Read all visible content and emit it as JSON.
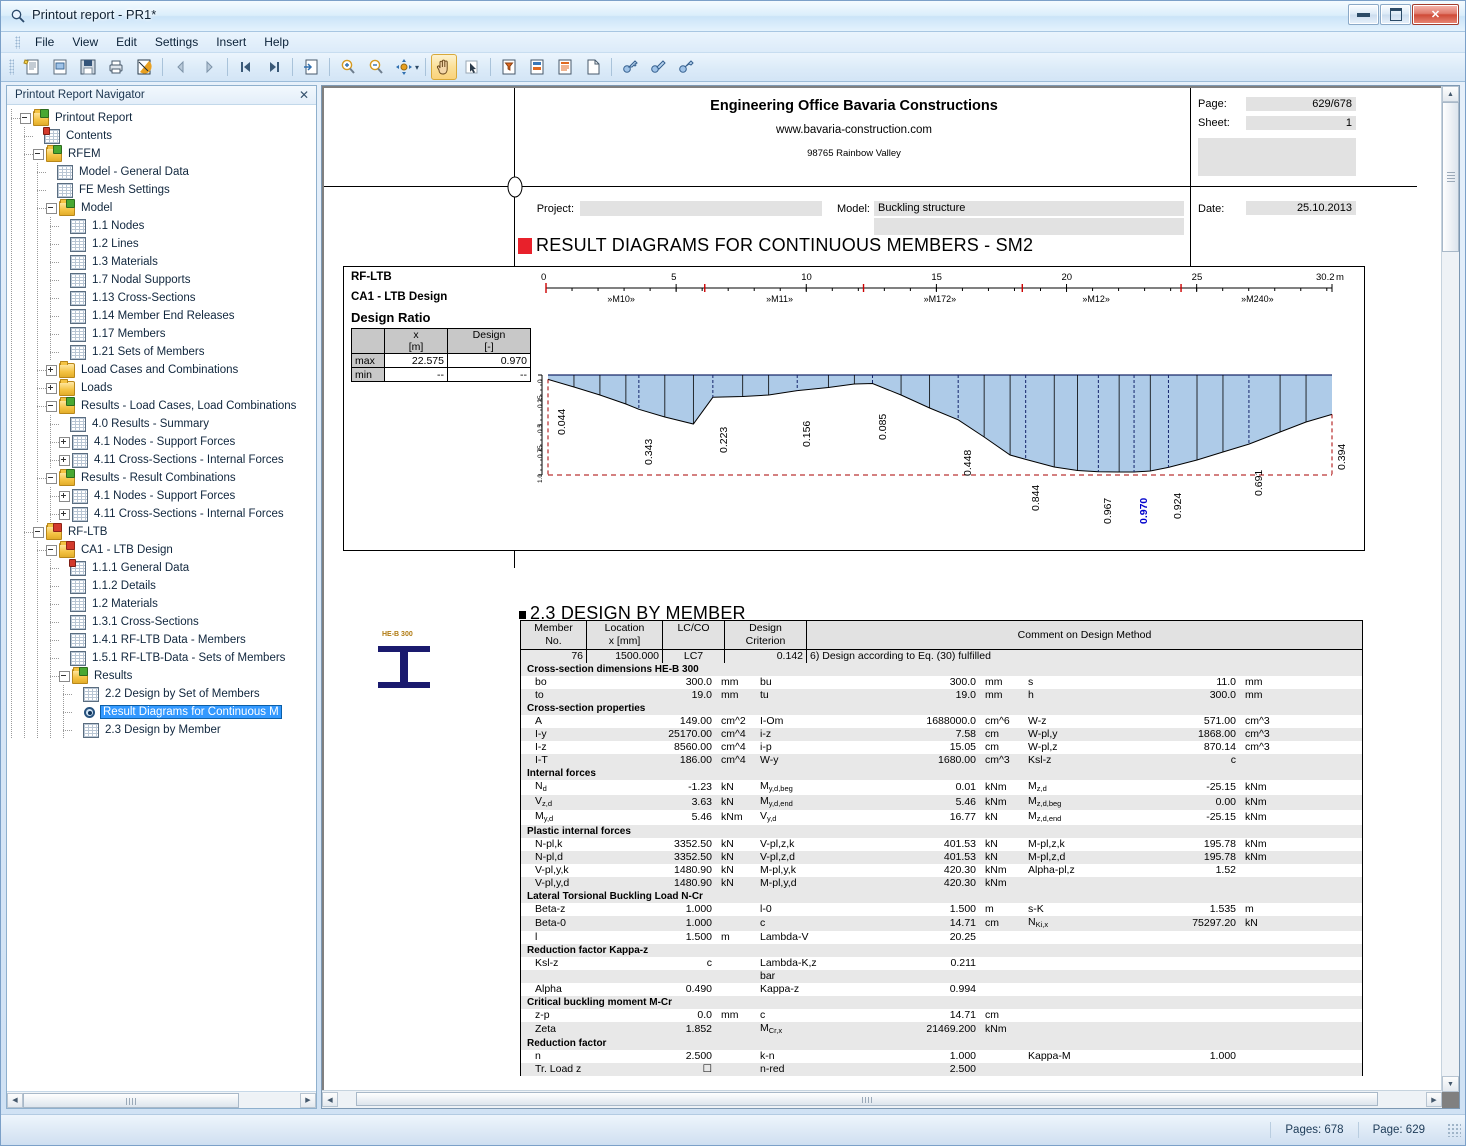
{
  "window": {
    "title": "Printout report - PR1*",
    "icon": "magnifier-icon",
    "minimize": "minimize-button",
    "maximize": "maximize-button",
    "close": "✕"
  },
  "menu": [
    "File",
    "View",
    "Edit",
    "Settings",
    "Insert",
    "Help"
  ],
  "toolbar": {
    "buttons": [
      {
        "name": "new-report-icon",
        "active": false
      },
      {
        "name": "open-report-icon",
        "active": false
      },
      {
        "name": "save-icon",
        "active": false
      },
      {
        "name": "print-icon",
        "active": false
      },
      {
        "name": "print-preview-icon",
        "active": false
      },
      {
        "name": "previous-page-icon",
        "active": false
      },
      {
        "name": "next-page-icon",
        "active": false
      },
      {
        "name": "first-page-icon",
        "active": false
      },
      {
        "name": "last-page-icon",
        "active": false
      },
      {
        "name": "export-icon",
        "active": false
      },
      {
        "name": "zoom-in-icon",
        "active": false
      },
      {
        "name": "zoom-out-icon",
        "active": false
      },
      {
        "name": "pan-move-icon",
        "active": false
      },
      {
        "name": "hand-tool-icon",
        "active": true
      },
      {
        "name": "select-pointer-icon",
        "active": false
      },
      {
        "name": "filter-page-icon",
        "active": false
      },
      {
        "name": "page-properties-icon",
        "active": false
      },
      {
        "name": "page-layout-icon",
        "active": false
      },
      {
        "name": "blank-page-icon",
        "active": false
      },
      {
        "name": "key-insert-icon",
        "active": false
      },
      {
        "name": "key-edit-icon",
        "active": false
      },
      {
        "name": "key-lock-icon",
        "active": false
      }
    ]
  },
  "navigator": {
    "title": "Printout Report Navigator",
    "close_label": "✕",
    "tree": [
      {
        "label": "Printout Report",
        "depth": 0,
        "icon": "folder-green",
        "exp": "minus"
      },
      {
        "label": "Contents",
        "depth": 1,
        "icon": "sheet-pin",
        "exp": ""
      },
      {
        "label": "RFEM",
        "depth": 1,
        "icon": "folder-green",
        "exp": "minus"
      },
      {
        "label": "Model - General Data",
        "depth": 2,
        "icon": "sheet",
        "exp": ""
      },
      {
        "label": "FE Mesh Settings",
        "depth": 2,
        "icon": "sheet",
        "exp": ""
      },
      {
        "label": "Model",
        "depth": 2,
        "icon": "folder-green",
        "exp": "minus"
      },
      {
        "label": "1.1 Nodes",
        "depth": 3,
        "icon": "sheet",
        "exp": ""
      },
      {
        "label": "1.2 Lines",
        "depth": 3,
        "icon": "sheet",
        "exp": ""
      },
      {
        "label": "1.3 Materials",
        "depth": 3,
        "icon": "sheet",
        "exp": ""
      },
      {
        "label": "1.7 Nodal Supports",
        "depth": 3,
        "icon": "sheet",
        "exp": ""
      },
      {
        "label": "1.13 Cross-Sections",
        "depth": 3,
        "icon": "sheet",
        "exp": ""
      },
      {
        "label": "1.14 Member End Releases",
        "depth": 3,
        "icon": "sheet",
        "exp": ""
      },
      {
        "label": "1.17 Members",
        "depth": 3,
        "icon": "sheet",
        "exp": ""
      },
      {
        "label": "1.21 Sets of Members",
        "depth": 3,
        "icon": "sheet",
        "exp": ""
      },
      {
        "label": "Load Cases and Combinations",
        "depth": 2,
        "icon": "folder",
        "exp": "plus"
      },
      {
        "label": "Loads",
        "depth": 2,
        "icon": "folder",
        "exp": "plus"
      },
      {
        "label": "Results - Load Cases, Load Combinations",
        "depth": 2,
        "icon": "folder-green",
        "exp": "minus"
      },
      {
        "label": "4.0 Results - Summary",
        "depth": 3,
        "icon": "sheet",
        "exp": ""
      },
      {
        "label": "4.1 Nodes - Support Forces",
        "depth": 3,
        "icon": "sheet",
        "exp": "plus"
      },
      {
        "label": "4.11 Cross-Sections - Internal Forces",
        "depth": 3,
        "icon": "sheet",
        "exp": "plus"
      },
      {
        "label": "Results - Result Combinations",
        "depth": 2,
        "icon": "folder-green",
        "exp": "minus"
      },
      {
        "label": "4.1 Nodes - Support Forces",
        "depth": 3,
        "icon": "sheet",
        "exp": "plus"
      },
      {
        "label": "4.11 Cross-Sections - Internal Forces",
        "depth": 3,
        "icon": "sheet",
        "exp": "plus"
      },
      {
        "label": "RF-LTB",
        "depth": 1,
        "icon": "folder-red",
        "exp": "minus"
      },
      {
        "label": "CA1 - LTB Design",
        "depth": 2,
        "icon": "folder-red",
        "exp": "minus"
      },
      {
        "label": "1.1.1 General Data",
        "depth": 3,
        "icon": "sheet-pin",
        "exp": ""
      },
      {
        "label": "1.1.2 Details",
        "depth": 3,
        "icon": "sheet",
        "exp": ""
      },
      {
        "label": "1.2 Materials",
        "depth": 3,
        "icon": "sheet",
        "exp": ""
      },
      {
        "label": "1.3.1 Cross-Sections",
        "depth": 3,
        "icon": "sheet",
        "exp": ""
      },
      {
        "label": "1.4.1 RF-LTB Data - Members",
        "depth": 3,
        "icon": "sheet",
        "exp": ""
      },
      {
        "label": "1.5.1 RF-LTB-Data - Sets of Members",
        "depth": 3,
        "icon": "sheet",
        "exp": ""
      },
      {
        "label": "Results",
        "depth": 3,
        "icon": "folder-green",
        "exp": "minus"
      },
      {
        "label": "2.2 Design by Set of Members",
        "depth": 4,
        "icon": "sheet",
        "exp": ""
      },
      {
        "label": "Result Diagrams for Continuous M",
        "depth": 4,
        "icon": "eye",
        "exp": "",
        "selected": true
      },
      {
        "label": "2.3 Design by Member",
        "depth": 4,
        "icon": "sheet",
        "exp": ""
      }
    ]
  },
  "report": {
    "header": {
      "company": "Engineering Office Bavaria Constructions",
      "website": "www.bavaria-construction.com",
      "address": "98765 Rainbow Valley",
      "page_label": "Page:",
      "page_value": "629/678",
      "sheet_label": "Sheet:",
      "sheet_value": "1",
      "project_label": "Project:",
      "project_value": "",
      "model_label": "Model:",
      "model_value": "Buckling structure",
      "date_label": "Date:",
      "date_value": "25.10.2013"
    },
    "section1": {
      "title": "RESULT DIAGRAMS FOR CONTINUOUS MEMBERS -  SM2"
    },
    "diagram": {
      "module": "RF-LTB",
      "case": "CA1 - LTB Design",
      "caption": "Design Ratio",
      "table": {
        "headers": [
          "",
          "x\n[m]",
          "Design\n[-]"
        ],
        "head_x": "x",
        "head_x_unit": "[m]",
        "head_d": "Design",
        "head_d_unit": "[-]",
        "rows": [
          {
            "key": "max",
            "x": "22.575",
            "design": "0.970"
          },
          {
            "key": "min",
            "x": "--",
            "design": "--"
          }
        ]
      },
      "unit_suffix": "m"
    },
    "section2": {
      "title": "2.3 DESIGN BY MEMBER",
      "headers": {
        "member": "Member",
        "member2": "No.",
        "location": "Location",
        "location2": "x [mm]",
        "lcco": "LC/CO",
        "design": "Design",
        "design2": "Criterion",
        "comment": "Comment on Design Method"
      },
      "first_row": {
        "member_no": "76",
        "location": "1500.000",
        "lcco": "LC7",
        "criterion": "0.142",
        "comment": "6) Design according to Eq. (30) fulfilled"
      },
      "cross_section_icon_label": "HE-B 300",
      "groups": [
        {
          "title": "Cross-section dimensions HE-B 300",
          "rows": [
            [
              [
                "bo",
                "300.0",
                "mm"
              ],
              [
                "bu",
                "300.0",
                "mm"
              ],
              [
                "s",
                "11.0",
                "mm"
              ]
            ],
            [
              [
                "to",
                "19.0",
                "mm"
              ],
              [
                "tu",
                "19.0",
                "mm"
              ],
              [
                "h",
                "300.0",
                "mm"
              ]
            ]
          ]
        },
        {
          "title": "Cross-section properties",
          "rows": [
            [
              [
                "A",
                "149.00",
                "cm^2"
              ],
              [
                "I-Om",
                "1688000.0",
                "cm^6"
              ],
              [
                "W-z",
                "571.00",
                "cm^3"
              ]
            ],
            [
              [
                "I-y",
                "25170.00",
                "cm^4"
              ],
              [
                "i-z",
                "7.58",
                "cm"
              ],
              [
                "W-pl,y",
                "1868.00",
                "cm^3"
              ]
            ],
            [
              [
                "I-z",
                "8560.00",
                "cm^4"
              ],
              [
                "i-p",
                "15.05",
                "cm"
              ],
              [
                "W-pl,z",
                "870.14",
                "cm^3"
              ]
            ],
            [
              [
                "I-T",
                "186.00",
                "cm^4"
              ],
              [
                "W-y",
                "1680.00",
                "cm^3"
              ],
              [
                "Ksl-z",
                "c",
                ""
              ]
            ]
          ]
        },
        {
          "title": "Internal forces",
          "rows": [
            [
              [
                "N_d",
                "-1.23",
                "kN"
              ],
              [
                "M_y,d,beg",
                "0.01",
                "kNm"
              ],
              [
                "M_z,d",
                "-25.15",
                "kNm"
              ]
            ],
            [
              [
                "V_z,d",
                "3.63",
                "kN"
              ],
              [
                "M_y,d,end",
                "5.46",
                "kNm"
              ],
              [
                "M_z,d,beg",
                "0.00",
                "kNm"
              ]
            ],
            [
              [
                "M_y,d",
                "5.46",
                "kNm"
              ],
              [
                "V_y,d",
                "16.77",
                "kN"
              ],
              [
                "M_z,d,end",
                "-25.15",
                "kNm"
              ]
            ]
          ]
        },
        {
          "title": "Plastic internal forces",
          "rows": [
            [
              [
                "N-pl,k",
                "3352.50",
                "kN"
              ],
              [
                "V-pl,z,k",
                "401.53",
                "kN"
              ],
              [
                "M-pl,z,k",
                "195.78",
                "kNm"
              ]
            ],
            [
              [
                "N-pl,d",
                "3352.50",
                "kN"
              ],
              [
                "V-pl,z,d",
                "401.53",
                "kN"
              ],
              [
                "M-pl,z,d",
                "195.78",
                "kNm"
              ]
            ],
            [
              [
                "V-pl,y,k",
                "1480.90",
                "kN"
              ],
              [
                "M-pl,y,k",
                "420.30",
                "kNm"
              ],
              [
                "Alpha-pl,z",
                "1.52",
                ""
              ]
            ],
            [
              [
                "V-pl,y,d",
                "1480.90",
                "kN"
              ],
              [
                "M-pl,y,d",
                "420.30",
                "kNm"
              ],
              [
                "",
                "",
                ""
              ]
            ]
          ]
        },
        {
          "title": "Lateral Torsional Buckling Load N-Cr",
          "rows": [
            [
              [
                "Beta-z",
                "1.000",
                ""
              ],
              [
                "l-0",
                "1.500",
                "m"
              ],
              [
                "s-K",
                "1.535",
                "m"
              ]
            ],
            [
              [
                "Beta-0",
                "1.000",
                ""
              ],
              [
                "c",
                "14.71",
                "cm"
              ],
              [
                "N_Ki,x",
                "75297.20",
                "kN"
              ]
            ],
            [
              [
                "l",
                "1.500",
                "m"
              ],
              [
                "Lambda-V",
                "20.25",
                ""
              ],
              [
                "",
                "",
                ""
              ]
            ]
          ]
        },
        {
          "title": "Reduction factor Kappa-z",
          "rows": [
            [
              [
                "Ksl-z",
                "c",
                ""
              ],
              [
                "Lambda-K,z",
                "0.211",
                ""
              ],
              [
                "",
                "",
                ""
              ]
            ],
            [
              [
                "",
                "",
                ""
              ],
              [
                "bar",
                "",
                ""
              ],
              [
                "",
                "",
                ""
              ]
            ],
            [
              [
                "Alpha",
                "0.490",
                ""
              ],
              [
                "Kappa-z",
                "0.994",
                ""
              ],
              [
                "",
                "",
                ""
              ]
            ]
          ]
        },
        {
          "title": "Critical buckling moment M-Cr",
          "rows": [
            [
              [
                "z-p",
                "0.0",
                "mm"
              ],
              [
                "c",
                "14.71",
                "cm"
              ],
              [
                "",
                "",
                ""
              ]
            ],
            [
              [
                "Zeta",
                "1.852",
                ""
              ],
              [
                "M_Cr,x",
                "21469.200",
                "kNm"
              ],
              [
                "",
                "",
                ""
              ]
            ]
          ]
        },
        {
          "title": "Reduction factor",
          "rows": [
            [
              [
                "n",
                "2.500",
                ""
              ],
              [
                "k-n",
                "1.000",
                ""
              ],
              [
                "Kappa-M",
                "1.000",
                ""
              ]
            ],
            [
              [
                "Tr. Load z",
                "☐",
                ""
              ],
              [
                "n-red",
                "2.500",
                ""
              ],
              [
                "",
                "",
                ""
              ]
            ]
          ]
        }
      ]
    }
  },
  "chart_data": {
    "type": "area",
    "title": "Design Ratio",
    "xlabel": "m",
    "ylabel": "Design [-]",
    "xlim": [
      0,
      30.2
    ],
    "ylim": [
      0,
      1.0
    ],
    "x_ticks": [
      "0",
      "5",
      "10",
      "15",
      "20",
      "25",
      "30.2"
    ],
    "y_ticks": [
      "0",
      "0.25",
      "0.5",
      "0.75",
      "1.0"
    ],
    "member_labels": [
      "»M10»",
      "»M11»",
      "»M172»",
      "»M12»",
      "»M240»"
    ],
    "limit_line": 1.0,
    "max_marker": {
      "x": 22.575,
      "value": 0.97
    },
    "labels": [
      {
        "x": 0.15,
        "value": "0.044"
      },
      {
        "x": 3.5,
        "value": "0.343"
      },
      {
        "x": 6.4,
        "value": "0.223"
      },
      {
        "x": 9.6,
        "value": "0.156"
      },
      {
        "x": 12.5,
        "value": "0.085"
      },
      {
        "x": 15.8,
        "value": "0.448"
      },
      {
        "x": 18.4,
        "value": "0.844"
      },
      {
        "x": 21.2,
        "value": "0.967"
      },
      {
        "x": 22.575,
        "value": "0.970",
        "highlight": true
      },
      {
        "x": 23.9,
        "value": "0.924"
      },
      {
        "x": 27.0,
        "value": "0.691"
      },
      {
        "x": 30.2,
        "value": "0.394"
      }
    ],
    "points": [
      [
        0.0,
        0.044
      ],
      [
        1.0,
        0.12
      ],
      [
        2.0,
        0.2
      ],
      [
        3.0,
        0.29
      ],
      [
        3.5,
        0.343
      ],
      [
        4.5,
        0.42
      ],
      [
        5.6,
        0.49
      ],
      [
        6.35,
        0.223
      ],
      [
        7.5,
        0.215
      ],
      [
        8.5,
        0.2
      ],
      [
        9.6,
        0.156
      ],
      [
        10.8,
        0.125
      ],
      [
        11.8,
        0.09
      ],
      [
        12.5,
        0.085
      ],
      [
        13.6,
        0.2
      ],
      [
        14.7,
        0.33
      ],
      [
        15.8,
        0.448
      ],
      [
        16.8,
        0.62
      ],
      [
        17.8,
        0.8
      ],
      [
        18.4,
        0.844
      ],
      [
        19.5,
        0.92
      ],
      [
        20.4,
        0.955
      ],
      [
        21.2,
        0.967
      ],
      [
        22.0,
        0.97
      ],
      [
        22.575,
        0.97
      ],
      [
        23.2,
        0.96
      ],
      [
        23.9,
        0.924
      ],
      [
        25.0,
        0.85
      ],
      [
        26.0,
        0.77
      ],
      [
        27.0,
        0.691
      ],
      [
        28.2,
        0.57
      ],
      [
        29.2,
        0.47
      ],
      [
        30.2,
        0.394
      ]
    ]
  },
  "status": {
    "pages": "Pages: 678",
    "page": "Page: 629"
  }
}
